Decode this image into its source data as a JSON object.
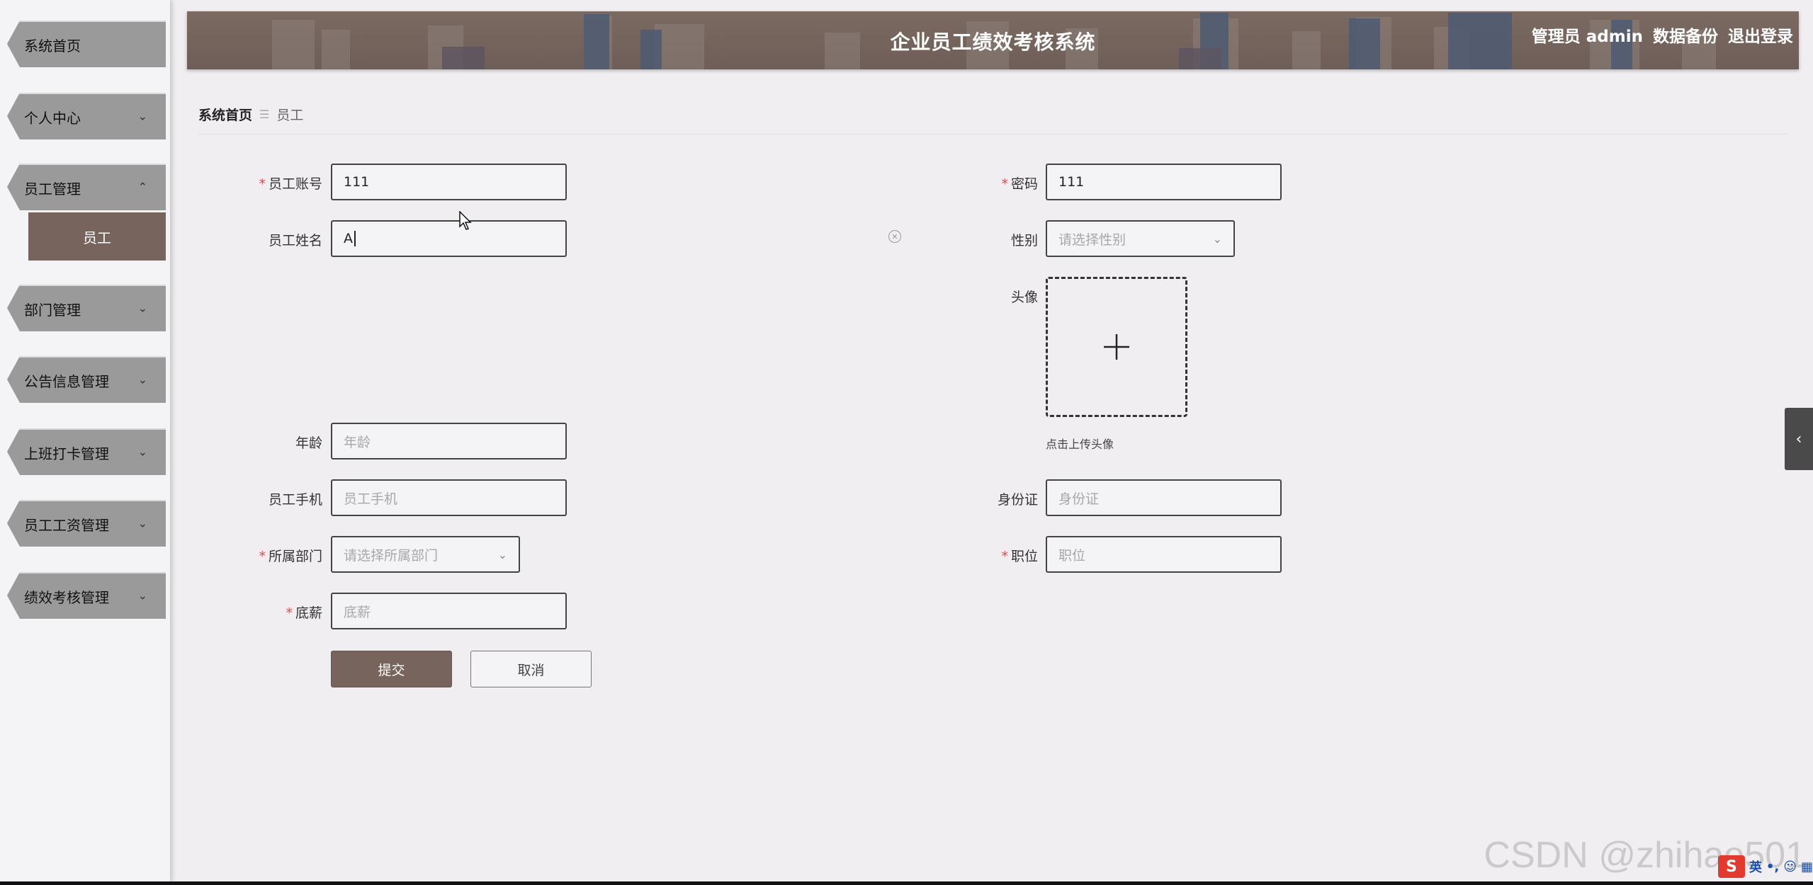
{
  "sidebar": {
    "items": [
      {
        "label": "系统首页",
        "chevron": ""
      },
      {
        "label": "个人中心",
        "chevron": "⌄"
      },
      {
        "label": "员工管理",
        "chevron": "⌃"
      },
      {
        "label": "部门管理",
        "chevron": "⌄"
      },
      {
        "label": "公告信息管理",
        "chevron": "⌄"
      },
      {
        "label": "上班打卡管理",
        "chevron": "⌄"
      },
      {
        "label": "员工工资管理",
        "chevron": "⌄"
      },
      {
        "label": "绩效考核管理",
        "chevron": "⌄"
      }
    ],
    "active_sub": "员工"
  },
  "header": {
    "title": "企业员工绩效考核系统",
    "admin": "管理员 admin",
    "backup": "数据备份",
    "logout": "退出登录"
  },
  "breadcrumb": {
    "home": "系统首页",
    "sep": "☰",
    "current": "员工"
  },
  "form": {
    "account": {
      "label": "员工账号",
      "value": "111"
    },
    "password": {
      "label": "密码",
      "value": "111"
    },
    "name": {
      "label": "员工姓名",
      "value": "A"
    },
    "gender": {
      "label": "性别",
      "placeholder": "请选择性别"
    },
    "avatar": {
      "label": "头像",
      "tip": "点击上传头像"
    },
    "age": {
      "label": "年龄",
      "placeholder": "年龄"
    },
    "phone": {
      "label": "员工手机",
      "placeholder": "员工手机"
    },
    "idcard": {
      "label": "身份证",
      "placeholder": "身份证"
    },
    "dept": {
      "label": "所属部门",
      "placeholder": "请选择所属部门"
    },
    "position": {
      "label": "职位",
      "placeholder": "职位"
    },
    "salary": {
      "label": "底薪",
      "placeholder": "底薪"
    },
    "submit": "提交",
    "cancel": "取消"
  },
  "watermark": "CSDN @zhihao501",
  "ime_label": "英",
  "colors": {
    "accent": "#77645c",
    "required": "#e24a4a"
  }
}
